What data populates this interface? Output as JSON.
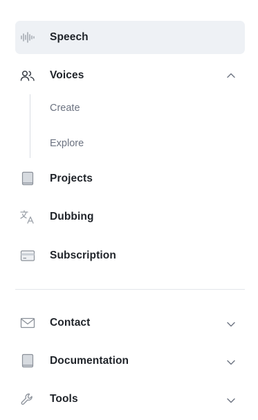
{
  "nav": {
    "speech": {
      "label": "Speech",
      "icon": "waveform-icon",
      "active": true
    },
    "voices": {
      "label": "Voices",
      "icon": "users-icon",
      "expanded": true,
      "children": [
        {
          "label": "Create"
        },
        {
          "label": "Explore"
        }
      ]
    },
    "projects": {
      "label": "Projects",
      "icon": "book-icon"
    },
    "dubbing": {
      "label": "Dubbing",
      "icon": "translate-icon"
    },
    "subscription": {
      "label": "Subscription",
      "icon": "credit-card-icon"
    }
  },
  "footer_nav": {
    "contact": {
      "label": "Contact",
      "icon": "mail-icon"
    },
    "documentation": {
      "label": "Documentation",
      "icon": "book-icon"
    },
    "tools": {
      "label": "Tools",
      "icon": "wrench-icon"
    }
  },
  "colors": {
    "active_bg": "#eef1f5",
    "text": "#1f2329",
    "muted": "#6b7280"
  }
}
